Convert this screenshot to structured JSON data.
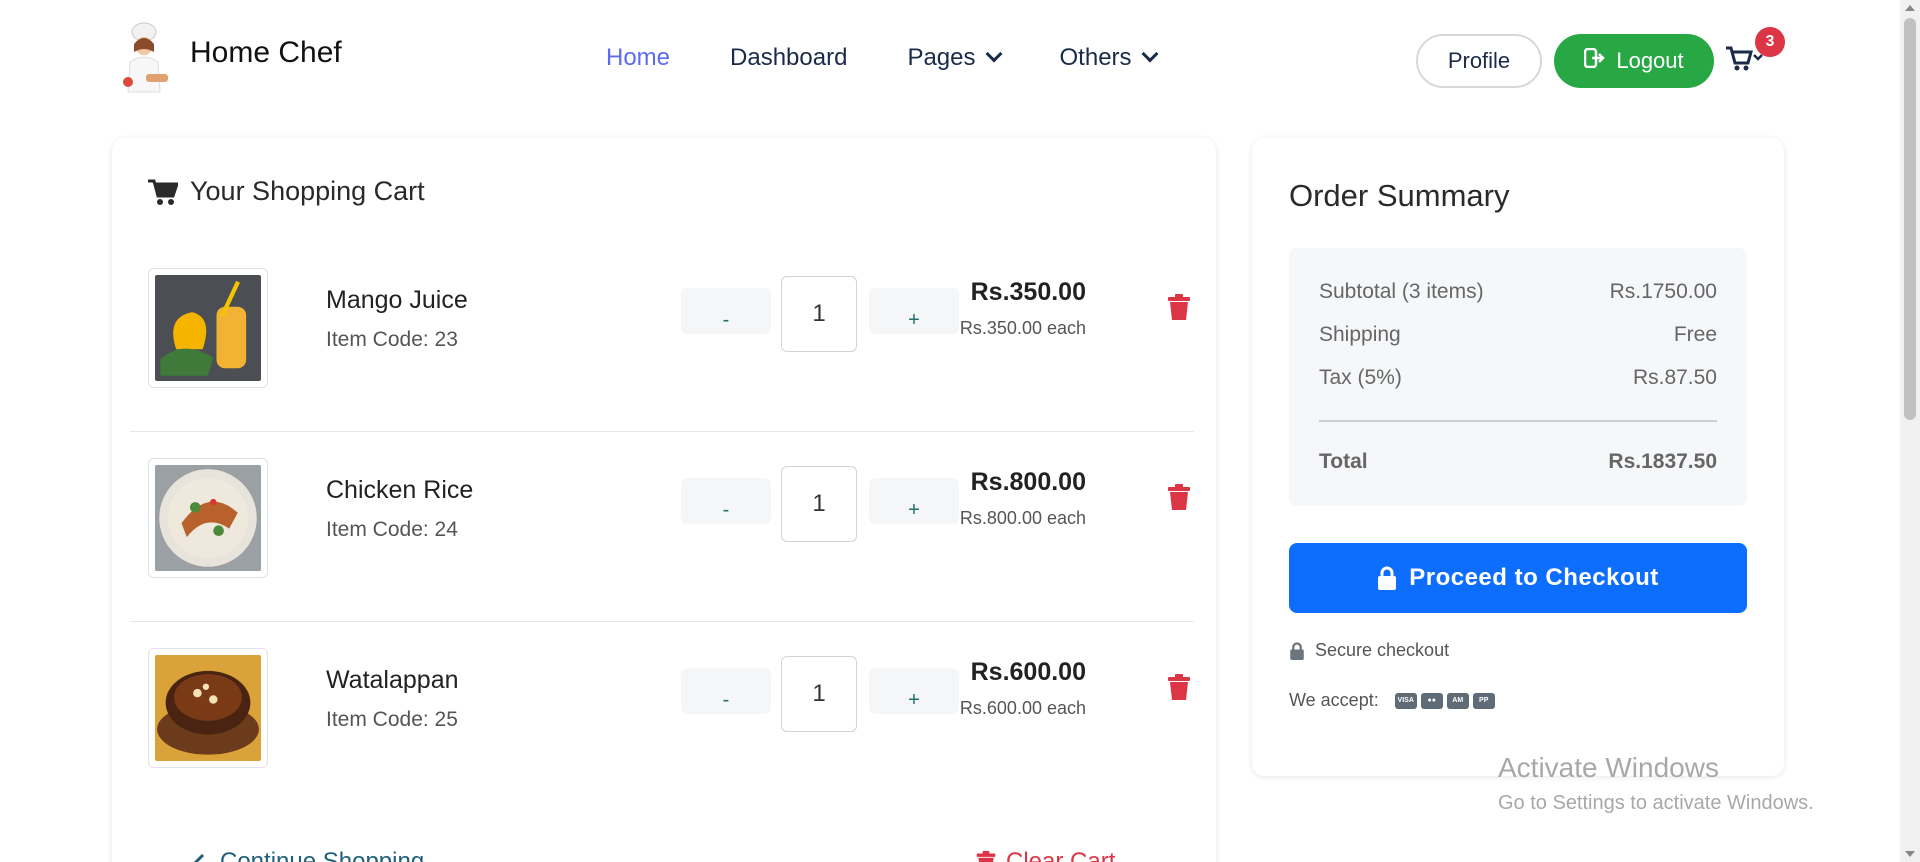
{
  "brand": {
    "name": "Home Chef"
  },
  "nav": [
    {
      "label": "Home",
      "active": true,
      "dropdown": false
    },
    {
      "label": "Dashboard",
      "active": false,
      "dropdown": false
    },
    {
      "label": "Pages",
      "active": false,
      "dropdown": true
    },
    {
      "label": "Others",
      "active": false,
      "dropdown": true
    }
  ],
  "header": {
    "profile_label": "Profile",
    "logout_label": "Logout",
    "cart_count": "3"
  },
  "cart": {
    "title": "Your Shopping Cart",
    "items": [
      {
        "name": "Mango Juice",
        "code": "Item Code: 23",
        "minus": "-",
        "qty": "1",
        "plus": "+",
        "price": "Rs.350.00",
        "each": "Rs.350.00 each"
      },
      {
        "name": "Chicken Rice",
        "code": "Item Code: 24",
        "minus": "-",
        "qty": "1",
        "plus": "+",
        "price": "Rs.800.00",
        "each": "Rs.800.00 each"
      },
      {
        "name": "Watalappan",
        "code": "Item Code: 25",
        "minus": "-",
        "qty": "1",
        "plus": "+",
        "price": "Rs.600.00",
        "each": "Rs.600.00 each"
      }
    ],
    "continue_label": "Continue Shopping",
    "clear_label": "Clear Cart"
  },
  "summary": {
    "title": "Order Summary",
    "subtotal_label": "Subtotal (3 items)",
    "subtotal_value": "Rs.1750.00",
    "shipping_label": "Shipping",
    "shipping_value": "Free",
    "tax_label": "Tax (5%)",
    "tax_value": "Rs.87.50",
    "total_label": "Total",
    "total_value": "Rs.1837.50",
    "checkout_label": "Proceed to Checkout",
    "secure_label": "Secure checkout",
    "accept_label": "We accept:",
    "payment_icons": [
      "visa-icon",
      "mastercard-icon",
      "amex-icon",
      "paypal-icon"
    ]
  },
  "watermark": {
    "title": "Activate Windows",
    "subtitle": "Go to Settings to activate Windows."
  },
  "colors": {
    "accent": "#0d6efd",
    "logout": "#28a745",
    "danger": "#dc3545",
    "active_nav": "#5b6cf0"
  }
}
